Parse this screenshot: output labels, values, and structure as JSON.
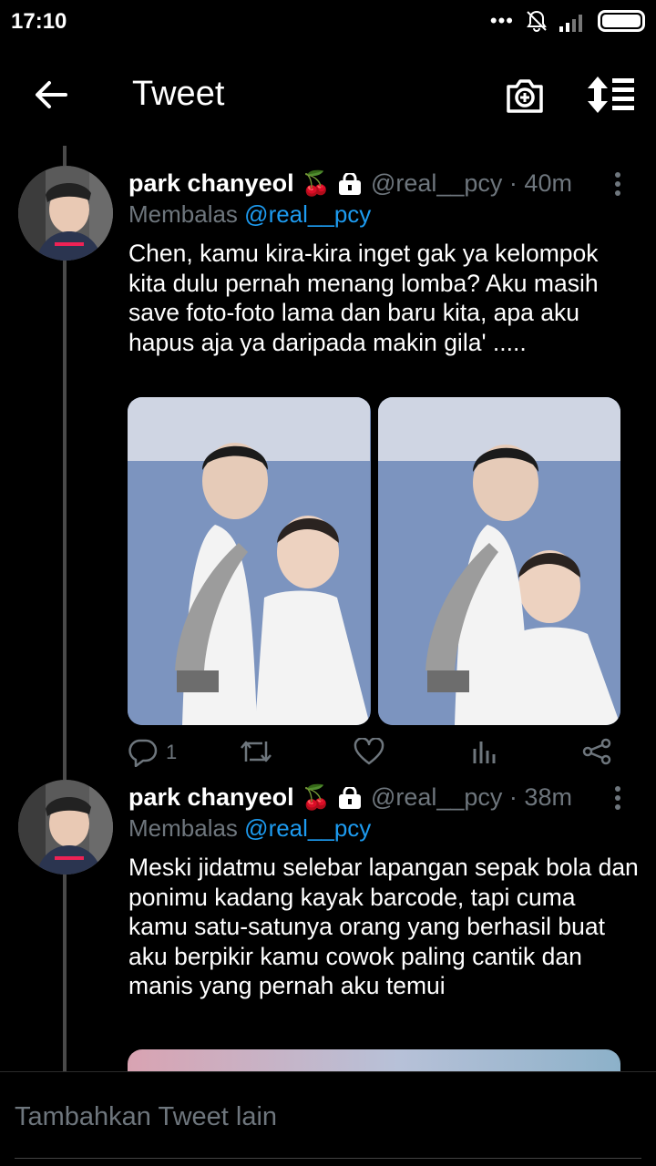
{
  "status_bar": {
    "time": "17:10",
    "dots": "•••"
  },
  "header": {
    "title": "Tweet"
  },
  "tweets": [
    {
      "author": "park chanyeol",
      "badge_emoji": "🍒",
      "handle_time": "@real__pcy · 40m",
      "reply_prefix": "Membalas",
      "reply_to": "@real__pcy",
      "text": "Chen, kamu kira-kira inget gak ya kelompok kita dulu pernah menang lomba? Aku masih save foto-foto lama dan baru kita, apa aku hapus aja ya daripada makin gila' .....",
      "reply_count": "1"
    },
    {
      "author": "park chanyeol",
      "badge_emoji": "🍒",
      "handle_time": "@real__pcy · 38m",
      "reply_prefix": "Membalas",
      "reply_to": "@real__pcy",
      "text": "Meski jidatmu selebar lapangan sepak bola dan ponimu kadang kayak barcode, tapi cuma kamu satu-satunya orang yang berhasil buat aku berpikir kamu cowok paling cantik dan manis yang  pernah aku temui"
    }
  ],
  "composer": {
    "placeholder": "Tambahkan Tweet lain"
  },
  "colors": {
    "accent": "#1d9bf0",
    "muted": "#6e767d",
    "background": "#000000"
  },
  "icons": [
    "back-arrow-icon",
    "camera-plus-icon",
    "sort-icon",
    "more-vert-icon",
    "lock-icon",
    "reply-icon",
    "retweet-icon",
    "like-icon",
    "analytics-icon",
    "share-icon"
  ]
}
